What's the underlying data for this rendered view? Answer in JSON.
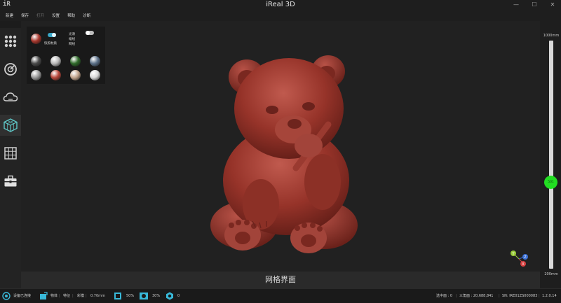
{
  "app": {
    "logo": "iR",
    "title": "iReal 3D"
  },
  "window_buttons": {
    "minimize": "—",
    "maximize": "☐",
    "close": "✕"
  },
  "menu": [
    {
      "label": "新建",
      "enabled": true
    },
    {
      "label": "保存",
      "enabled": true
    },
    {
      "label": "打开",
      "enabled": false
    },
    {
      "label": "设置",
      "enabled": true
    },
    {
      "label": "帮助",
      "enabled": true
    },
    {
      "label": "诊断",
      "enabled": true
    }
  ],
  "left_toolbar": [
    {
      "icon": "grid-dots-icon"
    },
    {
      "icon": "scan-target-icon"
    },
    {
      "icon": "cloud-icon"
    },
    {
      "icon": "mesh-cube-icon",
      "active": true
    },
    {
      "icon": "table-grid-icon"
    },
    {
      "icon": "toolbox-icon"
    }
  ],
  "material_panel": {
    "fast_material_label": "快照材质",
    "fast_material_on": true,
    "options": [
      "光滑",
      "缩线",
      "网线"
    ],
    "options_toggle_on": false,
    "swatches": [
      {
        "name": "dark-gray",
        "color": "#4a4a4a"
      },
      {
        "name": "silver",
        "color": "#b8b8b8"
      },
      {
        "name": "green-glass",
        "color": "#2f6a2a"
      },
      {
        "name": "blue-gray",
        "color": "#5b7088"
      },
      {
        "name": "light-gray",
        "color": "#9a9a9a"
      },
      {
        "name": "red-clay",
        "color": "#b9483c"
      },
      {
        "name": "tan",
        "color": "#c4a68e"
      },
      {
        "name": "white",
        "color": "#d8d8d8"
      }
    ],
    "current_color": "#a8372d"
  },
  "viewport_caption": "网格界面",
  "depth_slider": {
    "max_label": "1000mm",
    "min_label": "200mm",
    "value_label": "501"
  },
  "gizmo": {
    "y": "Y",
    "z": "Z",
    "x": "X"
  },
  "status": {
    "device": "设备已连接",
    "mode": "物体",
    "feature": "特征",
    "color_mode": "彩模",
    "resolution": "0.70mm",
    "brightness": "50%",
    "exposure": "30%",
    "count": "0",
    "selected": "选中面 : 0",
    "triangles": "三角面 : 20,688,841",
    "sn": "SN: IRE01ZS000083",
    "version": "1.2.0.14"
  }
}
